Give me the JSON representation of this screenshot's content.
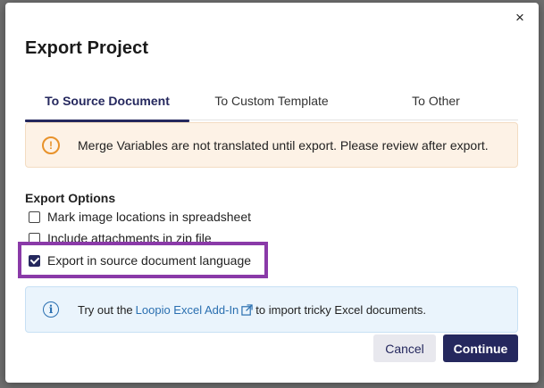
{
  "dialog": {
    "title": "Export Project",
    "close_label": "×"
  },
  "tabs": [
    {
      "label": "To Source Document",
      "active": true
    },
    {
      "label": "To Custom Template",
      "active": false
    },
    {
      "label": "To Other",
      "active": false
    }
  ],
  "warning": {
    "icon": "exclamation-circle-icon",
    "text": "Merge Variables are not translated until export. Please review after export."
  },
  "options": {
    "heading": "Export Options",
    "items": [
      {
        "label": "Mark image locations in spreadsheet",
        "checked": false
      },
      {
        "label": "Include attachments in zip file",
        "checked": false
      },
      {
        "label": "Export in source document language",
        "checked": true
      }
    ]
  },
  "info": {
    "icon": "info-circle-icon",
    "prefix": "Try out the",
    "link_text": "Loopio Excel Add-In",
    "suffix": "to import tricky Excel documents."
  },
  "buttons": {
    "cancel": "Cancel",
    "continue": "Continue"
  },
  "colors": {
    "primary": "#25285e",
    "highlight": "#8a3aa8",
    "warning_bg": "#fdf2e6",
    "warning_icon": "#e8922a",
    "info_bg": "#eaf4fc",
    "link": "#2a6fb0"
  }
}
